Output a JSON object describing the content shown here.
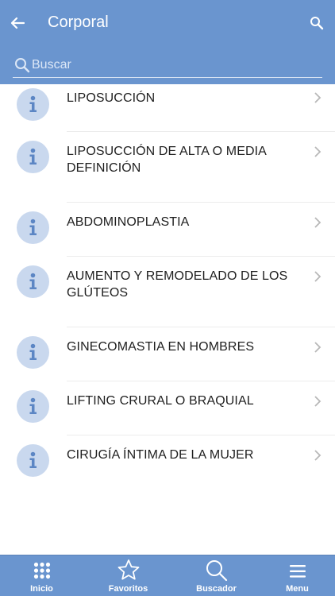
{
  "header": {
    "title": "Corporal",
    "back_icon": "back-arrow-icon",
    "search_icon": "search-icon",
    "background": "#6a95cf"
  },
  "search": {
    "placeholder": "Buscar",
    "value": ""
  },
  "list": {
    "items": [
      {
        "label": "LIPOSUCCIÓN",
        "icon": "info-icon"
      },
      {
        "label": "LIPOSUCCIÓN DE ALTA O MEDIA DEFINICIÓN",
        "icon": "info-icon"
      },
      {
        "label": "ABDOMINOPLASTIA",
        "icon": "info-icon"
      },
      {
        "label": "AUMENTO Y REMODELADO DE LOS GLÚTEOS",
        "icon": "info-icon"
      },
      {
        "label": "GINECOMASTIA EN HOMBRES",
        "icon": "info-icon"
      },
      {
        "label": "LIFTING CRURAL O BRAQUIAL",
        "icon": "info-icon"
      },
      {
        "label": "CIRUGÍA ÍNTIMA DE LA MUJER",
        "icon": "info-icon"
      }
    ]
  },
  "tabbar": {
    "tabs": [
      {
        "label": "Inicio",
        "icon": "grid-icon"
      },
      {
        "label": "Favoritos",
        "icon": "star-icon"
      },
      {
        "label": "Buscador",
        "icon": "search-icon"
      },
      {
        "label": "Menu",
        "icon": "hamburger-icon"
      }
    ]
  },
  "colors": {
    "accent": "#6a95cf",
    "icon_circle": "#c9d8ee",
    "icon_glyph": "#5c86c4"
  }
}
